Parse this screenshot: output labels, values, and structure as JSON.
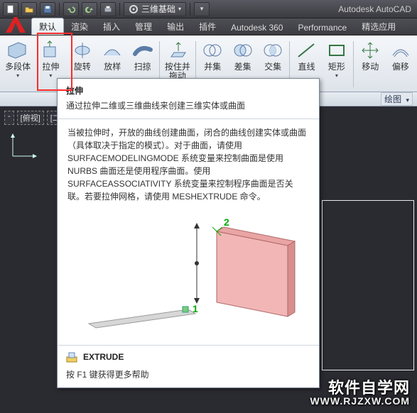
{
  "titlebar": {
    "workspace": "三维基础",
    "app_title": "Autodesk AutoCAD",
    "icons": {
      "new": "new-icon",
      "open": "open-icon",
      "save": "save-icon",
      "undo": "undo-icon",
      "redo": "redo-icon",
      "print": "print-icon",
      "gear": "gear-icon",
      "caret": "chevron-down-icon",
      "search": "search-icon"
    }
  },
  "tabs": {
    "items": [
      "默认",
      "渲染",
      "插入",
      "管理",
      "输出",
      "插件",
      "Autodesk 360",
      "Performance",
      "精选应用"
    ],
    "active_index": 0,
    "pill_label": "绘图"
  },
  "ribbon": {
    "buttons": [
      {
        "key": "polysolid",
        "label": "多段体"
      },
      {
        "key": "extrude",
        "label": "拉伸"
      },
      {
        "key": "revolve",
        "label": "旋转"
      },
      {
        "key": "loft",
        "label": "放样"
      },
      {
        "key": "sweep",
        "label": "扫掠"
      },
      {
        "key": "presspull",
        "label": "按住并拖动"
      },
      {
        "key": "union",
        "label": "并集"
      },
      {
        "key": "subtract",
        "label": "差集"
      },
      {
        "key": "intersect",
        "label": "交集"
      },
      {
        "key": "line",
        "label": "直线"
      },
      {
        "key": "rectangle",
        "label": "矩形"
      },
      {
        "key": "move",
        "label": "移动"
      },
      {
        "key": "offset",
        "label": "偏移"
      }
    ]
  },
  "view": {
    "tabs": [
      "-",
      "[俯视]",
      "[二维"
    ]
  },
  "tooltip": {
    "title": "拉伸",
    "short": "通过拉伸二维或三维曲线来创建三维实体或曲面",
    "long": "当被拉伸时，开放的曲线创建曲面，闭合的曲线创建实体或曲面（具体取决于指定的模式）。对于曲面，请使用 SURFACEMODELINGMODE 系统变量来控制曲面是使用 NURBS 曲面还是使用程序曲面。使用 SURFACEASSOCIATIVITY 系统变量来控制程序曲面是否关联。若要拉伸网格，请使用 MESHEXTRUDE 命令。",
    "marker1": "1",
    "marker2": "2",
    "command_label": "EXTRUDE",
    "help": "按 F1 键获得更多帮助"
  },
  "watermark": {
    "line1": "软件自学网",
    "line2": "WWW.RJZXW.COM"
  }
}
